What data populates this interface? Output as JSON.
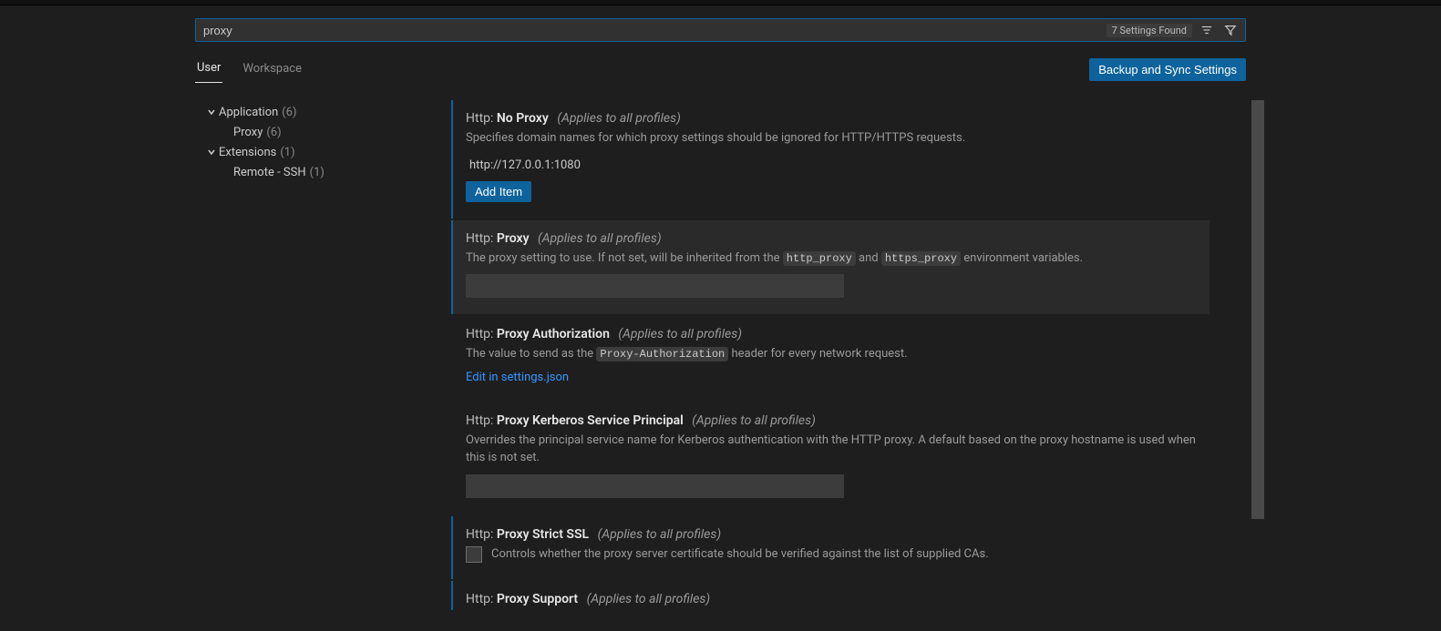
{
  "search": {
    "value": "proxy",
    "found_text": "7 Settings Found"
  },
  "tabs": {
    "user": "User",
    "workspace": "Workspace"
  },
  "backup_label": "Backup and Sync Settings",
  "sidebar": {
    "application": {
      "label": "Application",
      "count": "(6)"
    },
    "proxy": {
      "label": "Proxy",
      "count": "(6)"
    },
    "extensions": {
      "label": "Extensions",
      "count": "(1)"
    },
    "remote_ssh": {
      "label": "Remote - SSH",
      "count": "(1)"
    }
  },
  "settings": {
    "no_proxy": {
      "cat": "Http:",
      "name": "No Proxy",
      "scope": "(Applies to all profiles)",
      "desc": "Specifies domain names for which proxy settings should be ignored for HTTP/HTTPS requests.",
      "item": "http://127.0.0.1:1080",
      "add_item": "Add Item"
    },
    "proxy": {
      "cat": "Http:",
      "name": "Proxy",
      "scope": "(Applies to all profiles)",
      "desc_a": "The proxy setting to use. If not set, will be inherited from the ",
      "code1": "http_proxy",
      "desc_b": " and ",
      "code2": "https_proxy",
      "desc_c": " environment variables.",
      "value": ""
    },
    "proxy_auth": {
      "cat": "Http:",
      "name": "Proxy Authorization",
      "scope": "(Applies to all profiles)",
      "desc_a": "The value to send as the ",
      "code1": "Proxy-Authorization",
      "desc_b": " header for every network request.",
      "edit_link": "Edit in settings.json"
    },
    "kerberos": {
      "cat": "Http:",
      "name": "Proxy Kerberos Service Principal",
      "scope": "(Applies to all profiles)",
      "desc": "Overrides the principal service name for Kerberos authentication with the HTTP proxy. A default based on the proxy hostname is used when this is not set.",
      "value": ""
    },
    "strict_ssl": {
      "cat": "Http:",
      "name": "Proxy Strict SSL",
      "scope": "(Applies to all profiles)",
      "desc": "Controls whether the proxy server certificate should be verified against the list of supplied CAs."
    },
    "proxy_support": {
      "cat": "Http:",
      "name": "Proxy Support",
      "scope": "(Applies to all profiles)"
    }
  }
}
